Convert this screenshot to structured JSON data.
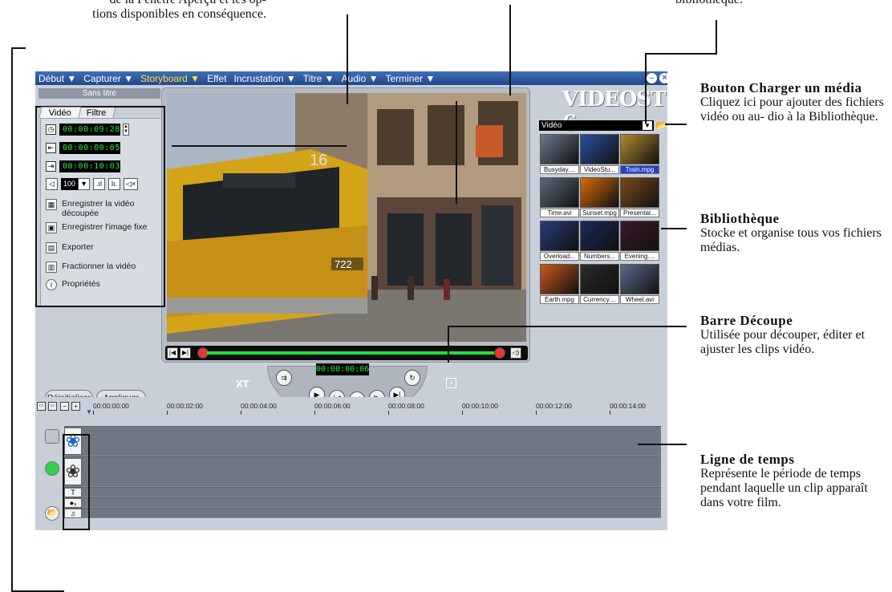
{
  "annotations": {
    "top_left": "de la Fenêtre Aperçu et les op-\ntions disponibles en conséquence.",
    "top_right": "bibliothèque.",
    "load_media_title": "Bouton Charger un média",
    "load_media_desc": "Cliquez ici pour ajouter des fichiers vidéo ou au- dio à la Bibliothèque.",
    "library_title": "Bibliothèque",
    "library_desc": "Stocke et organise tous vos fichiers médias.",
    "trim_title": "Barre Découpe",
    "trim_desc": "Utilisée pour découper, éditer et ajuster les clips vidéo.",
    "timeline_title": "Ligne de temps",
    "timeline_desc": "Représente le période de temps pendant laquelle un clip apparaît dans votre film."
  },
  "menu": [
    "Début ▼",
    "Capturer ▼",
    "Storyboard ▼",
    "Effet",
    "Incrustation ▼",
    "Titre ▼",
    "Audio ▼",
    "Terminer ▼"
  ],
  "menu_active_index": 2,
  "project_title": "Sans titre",
  "tabs": [
    "Vidéo",
    "Filtre"
  ],
  "timecodes": {
    "duration": "00:00:09:28",
    "mark_in": "00:00:00:05",
    "mark_out": "00:00:10:03"
  },
  "volume": "100",
  "actions": [
    "Enregistrer la vidéo découpée",
    "Enregistrer l'image fixe",
    "Exporter",
    "Fractionner la vidéo",
    "Propriétés"
  ],
  "player_timecode": "00:00:00:06",
  "buttons": {
    "reset": "Réinitialiser",
    "apply": "Appliquer"
  },
  "logo": "VIDEOSTUDIO 6",
  "library": {
    "category": "Vidéo",
    "items": [
      "Busyday....",
      "VideoStu...",
      "Train.mpg",
      "Time.avi",
      "Sunset.mpg",
      "Presentat...",
      "Overload...",
      "Numbers...",
      "Evening....",
      "Earth.mpg",
      "Currency....",
      "Wheel.avi"
    ],
    "selected_index": 2,
    "thumb_colors": [
      "#6a7a8c",
      "#2a4fa0",
      "#b28a2e",
      "#5a6a7a",
      "#d86a0a",
      "#7a4a1a",
      "#2a3a7a",
      "#1a2a5a",
      "#3a1a2a",
      "#c85a1a",
      "#2a2a2a",
      "#5a6a8a"
    ]
  },
  "ruler": [
    "00:00:00:00",
    "00:00:02:00",
    "00:00:04:00",
    "00:00:06:00",
    "00:00:08:00",
    "00:00:10:00",
    "00:00:12:00",
    "00:00:14:00"
  ],
  "colors": {
    "accent": "#ffe23a",
    "menu_bg": "#2c56a2",
    "timecode": "#22ee33",
    "selected": "#2240c8"
  },
  "video_number": "722",
  "video_sign": "16"
}
